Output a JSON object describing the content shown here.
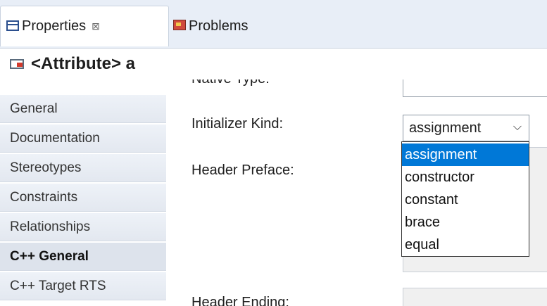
{
  "tabs": [
    {
      "label": "Properties",
      "close": "⊠",
      "icon": "properties-icon"
    },
    {
      "label": "Problems",
      "icon": "problems-icon"
    }
  ],
  "header": {
    "title": "<Attribute> a"
  },
  "sidebar": {
    "items": [
      {
        "label": "General"
      },
      {
        "label": "Documentation"
      },
      {
        "label": "Stereotypes"
      },
      {
        "label": "Constraints"
      },
      {
        "label": "Relationships"
      },
      {
        "label": "C++ General",
        "active": true
      },
      {
        "label": "C++ Target RTS"
      }
    ]
  },
  "form": {
    "cut_label": "Native Type:",
    "initializer_kind_label": "Initializer Kind:",
    "initializer_kind_value": "assignment",
    "header_preface_label": "Header Preface:",
    "header_ending_label": "Header Ending:"
  },
  "dropdown": {
    "options": [
      "assignment",
      "constructor",
      "constant",
      "brace",
      "equal"
    ],
    "selected": "assignment"
  },
  "colors": {
    "selection": "#0078d7",
    "tabbar": "#e8eef7"
  }
}
